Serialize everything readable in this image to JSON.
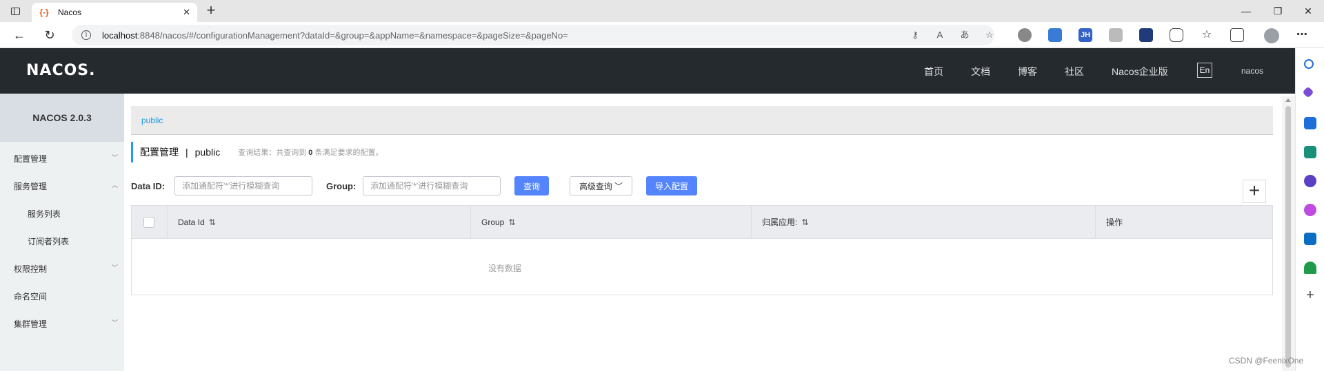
{
  "browser": {
    "tab_title": "Nacos",
    "tab_favicon": "{-}",
    "tab_close": "✕",
    "new_tab": "+",
    "url_host": "localhost",
    "url_rest": ":8848/nacos/#/configurationManagement?dataId=&group=&appName=&namespace=&pageSize=&pageNo=",
    "window_controls": [
      "—",
      "❐",
      "✕"
    ],
    "more_menu": "⋯"
  },
  "header": {
    "logo": "NACOS.",
    "nav": [
      "首页",
      "文档",
      "博客",
      "社区",
      "Nacos企业版"
    ],
    "lang": "En",
    "user": "nacos"
  },
  "sidebar": {
    "version": "NACOS 2.0.3",
    "items": [
      {
        "label": "配置管理"
      },
      {
        "label": "服务管理"
      },
      {
        "label": "服务列表"
      },
      {
        "label": "订阅者列表"
      },
      {
        "label": "权限控制"
      },
      {
        "label": "命名空间"
      },
      {
        "label": "集群管理"
      }
    ]
  },
  "main": {
    "namespace_tab": "public",
    "title": "配置管理",
    "separator": "|",
    "namespace": "public",
    "query_prefix": "查询结果：共查询到",
    "query_count": "0",
    "query_suffix": "条满足要求的配置。",
    "filters": {
      "data_id_label": "Data ID:",
      "data_id_placeholder": "添加通配符'*'进行模糊查询",
      "group_label": "Group:",
      "group_placeholder": "添加通配符'*'进行模糊查询",
      "search_button": "查询",
      "advanced_button": "高级查询",
      "import_button": "导入配置",
      "add_button": "+"
    },
    "table": {
      "columns": [
        "Data Id",
        "Group",
        "归属应用:",
        "操作"
      ],
      "sort_icon": "⇅",
      "empty_text": "没有数据"
    }
  },
  "watermark": "CSDN @FeenixOne"
}
